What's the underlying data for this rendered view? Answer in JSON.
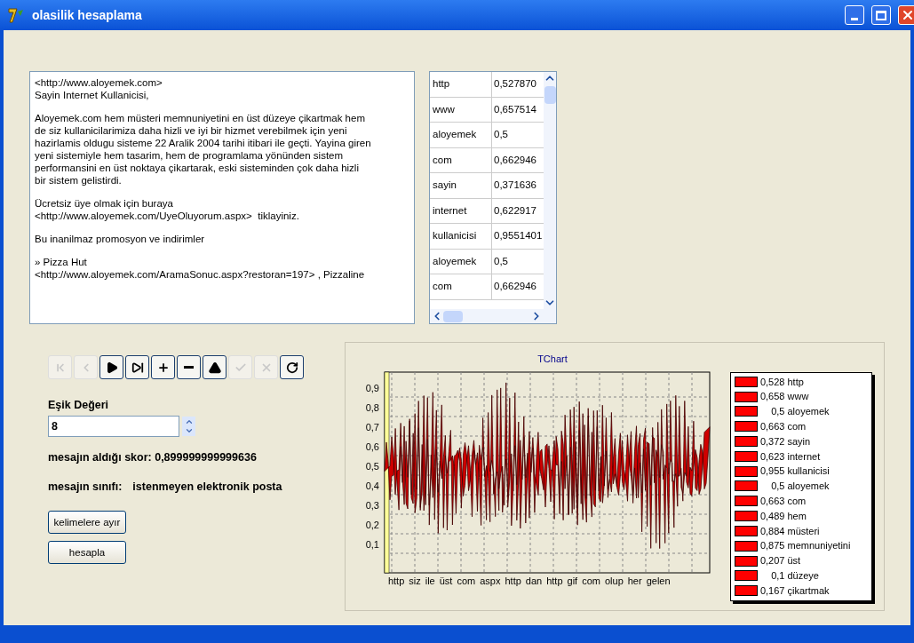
{
  "window": {
    "title": "olasilik hesaplama"
  },
  "message": {
    "paragraphs": [
      [
        "<http://www.aloyemek.com>",
        "Sayin Internet Kullanicisi,"
      ],
      [
        "Aloyemek.com hem müsteri memnuniyetini en üst düzeye çikartmak hem",
        "de siz kullanicilarimiza daha hizli ve iyi bir hizmet verebilmek için yeni",
        "hazirlamis oldugu sisteme 22 Aralik 2004 tarihi itibari ile geçti. Yayina giren",
        "yeni sistemiyle hem tasarim, hem de programlama yönünden sistem",
        "performansini en üst noktaya çikartarak, eski sisteminden çok daha hizli",
        "bir sistem gelistirdi."
      ],
      [
        "Ücretsiz üye olmak için buraya",
        "<http://www.aloyemek.com/UyeOluyorum.aspx>  tiklayiniz."
      ],
      [
        "Bu inanilmaz promosyon ve indirimler"
      ],
      [
        "» Pizza Hut",
        "<http://www.aloyemek.com/AramaSonuc.aspx?restoran=197> , Pizzaline"
      ]
    ]
  },
  "word_grid": {
    "rows": [
      {
        "word": "http",
        "score": "0,527870"
      },
      {
        "word": "www",
        "score": "0,657514"
      },
      {
        "word": "aloyemek",
        "score": "0,5"
      },
      {
        "word": "com",
        "score": "0,662946"
      },
      {
        "word": "sayin",
        "score": "0,371636"
      },
      {
        "word": "internet",
        "score": "0,622917"
      },
      {
        "word": "kullanicisi",
        "score": "0,9551401"
      },
      {
        "word": "aloyemek",
        "score": "0,5"
      },
      {
        "word": "com",
        "score": "0,662946"
      }
    ]
  },
  "navigator": [
    {
      "kind": "first",
      "disabled": true
    },
    {
      "kind": "prior",
      "disabled": true
    },
    {
      "kind": "next",
      "disabled": false
    },
    {
      "kind": "last",
      "disabled": false
    },
    {
      "kind": "insert",
      "disabled": false
    },
    {
      "kind": "delete",
      "disabled": false
    },
    {
      "kind": "edit",
      "disabled": false
    },
    {
      "kind": "post",
      "disabled": true
    },
    {
      "kind": "cancel",
      "disabled": true
    },
    {
      "kind": "refresh",
      "disabled": false
    }
  ],
  "threshold": {
    "label": "Eşik Değeri",
    "value": "8"
  },
  "score_text": "mesajın aldığı skor: 0,899999999999636",
  "class_label": "mesajın sınıfı:",
  "class_value": "istenmeyen elektronik posta",
  "buttons": [
    "kelimelere ayır",
    "hesapla"
  ],
  "chart": {
    "title": "TChart",
    "y_labels": [
      "0,9",
      "0,8",
      "0,7",
      "0,6",
      "0,5",
      "0,4",
      "0,3",
      "0,2",
      "0,1"
    ],
    "x_labels": [
      "http",
      "siz",
      "ile",
      "üst",
      "com",
      "aspx",
      "http",
      "dan",
      "http",
      "gif",
      "com",
      "olup",
      "her",
      "gelen"
    ],
    "legend": [
      {
        "entry": "0,528 http",
        "color": "#ff0000"
      },
      {
        "entry": "0,658 www",
        "color": "#ff0000"
      },
      {
        "entry": "    0,5 aloyemek",
        "color": "#ff0000"
      },
      {
        "entry": "0,663 com",
        "color": "#ff0000"
      },
      {
        "entry": "0,372 sayin",
        "color": "#ff0000"
      },
      {
        "entry": "0,623 internet",
        "color": "#ff0000"
      },
      {
        "entry": "0,955 kullanicisi",
        "color": "#ff0000"
      },
      {
        "entry": "    0,5 aloyemek",
        "color": "#ff0000"
      },
      {
        "entry": "0,663 com",
        "color": "#ff0000"
      },
      {
        "entry": "0,489 hem",
        "color": "#ff0000"
      },
      {
        "entry": "0,884 müsteri",
        "color": "#ff0000"
      },
      {
        "entry": "0,875 memnuniyetini",
        "color": "#ff0000"
      },
      {
        "entry": "0,207 üst",
        "color": "#ff0000"
      },
      {
        "entry": "    0,1 düzeye",
        "color": "#ff0000"
      },
      {
        "entry": "0,167 çikartmak",
        "color": "#ff0000"
      }
    ]
  }
}
